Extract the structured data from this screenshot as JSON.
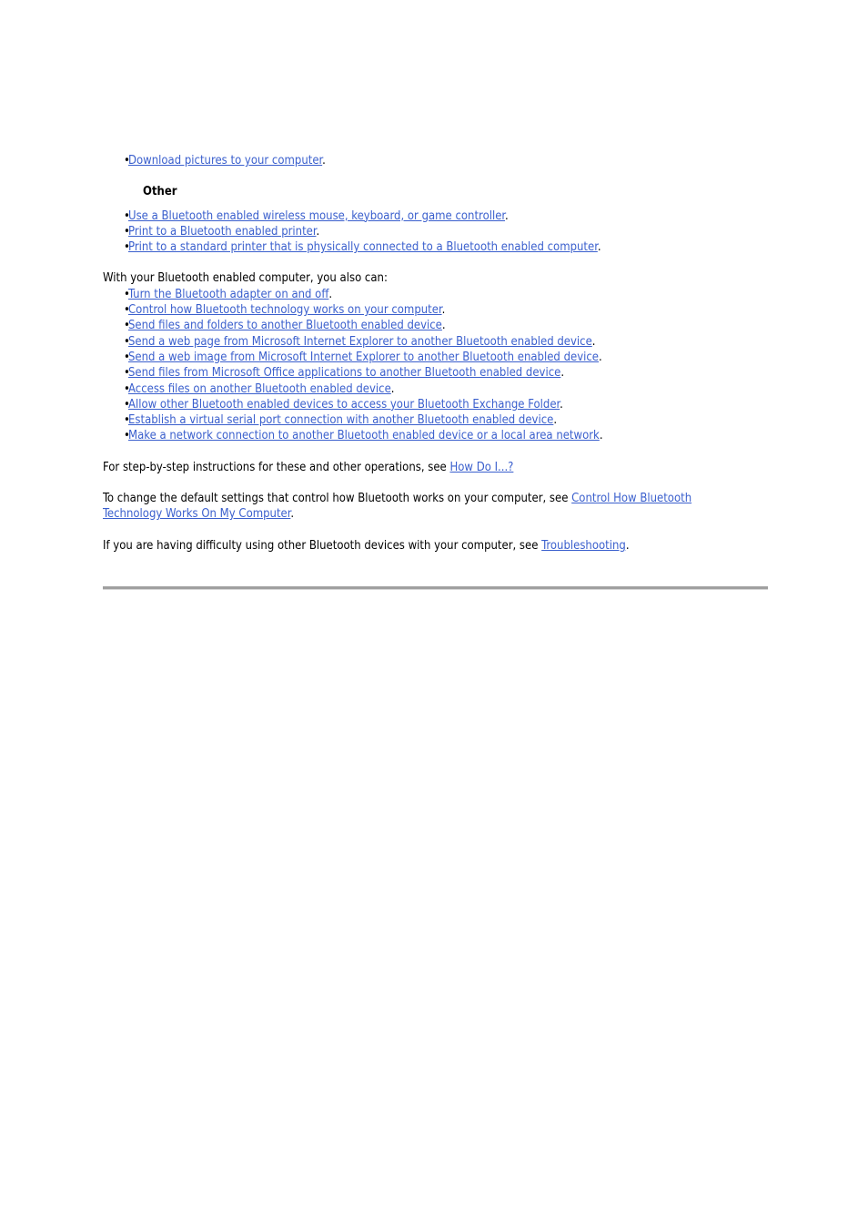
{
  "document": {
    "link_color": "#3a5fcd",
    "text_color": "#000000",
    "rule_color": "#a0a0a0",
    "background": "#ffffff"
  },
  "top_list": {
    "bullet": "•",
    "items": [
      {
        "link": "Download pictures to your computer",
        "trailing": "."
      }
    ]
  },
  "other_section": {
    "heading": "Other",
    "bullet": "•",
    "items": [
      {
        "link": "Use a Bluetooth enabled wireless mouse, keyboard, or game controller",
        "trailing": "."
      },
      {
        "link": "Print to a Bluetooth enabled printer",
        "trailing": "."
      },
      {
        "link": "Print to a standard printer that is physically connected to a Bluetooth enabled computer",
        "trailing": "."
      }
    ]
  },
  "also_can": {
    "intro": "With your Bluetooth enabled computer, you also can:",
    "bullet": "•",
    "items": [
      {
        "link": "Turn the Bluetooth adapter on and off",
        "trailing": "."
      },
      {
        "link": "Control how Bluetooth technology works on your computer",
        "trailing": "."
      },
      {
        "link": "Send files and folders to another Bluetooth enabled device",
        "trailing": "."
      },
      {
        "link": "Send a web page from Microsoft Internet Explorer to another Bluetooth enabled device",
        "trailing": "."
      },
      {
        "link": "Send a web image from Microsoft Internet Explorer to another Bluetooth enabled device",
        "trailing": "."
      },
      {
        "link": "Send files from Microsoft Office applications to another Bluetooth enabled device",
        "trailing": "."
      },
      {
        "link": "Access files on another Bluetooth enabled device",
        "trailing": "."
      },
      {
        "link": "Allow other Bluetooth enabled devices to access your Bluetooth Exchange Folder",
        "trailing": "."
      },
      {
        "link": "Establish a virtual serial port connection with another Bluetooth enabled device",
        "trailing": "."
      },
      {
        "link": "Make a network connection to another Bluetooth enabled device or a local area network",
        "trailing": "."
      }
    ]
  },
  "closing": {
    "p1_before": "For step-by-step instructions for these and other operations, see ",
    "p1_link": "How Do I...?",
    "p1_after": "",
    "p2_before": "To change the default settings that control how Bluetooth works on your computer, see ",
    "p2_link": "Control How Bluetooth Technology Works On My Computer",
    "p2_after": ".",
    "p3_before": "If you are having difficulty using other Bluetooth devices with your computer, see ",
    "p3_link": "Troubleshooting",
    "p3_after": "."
  }
}
